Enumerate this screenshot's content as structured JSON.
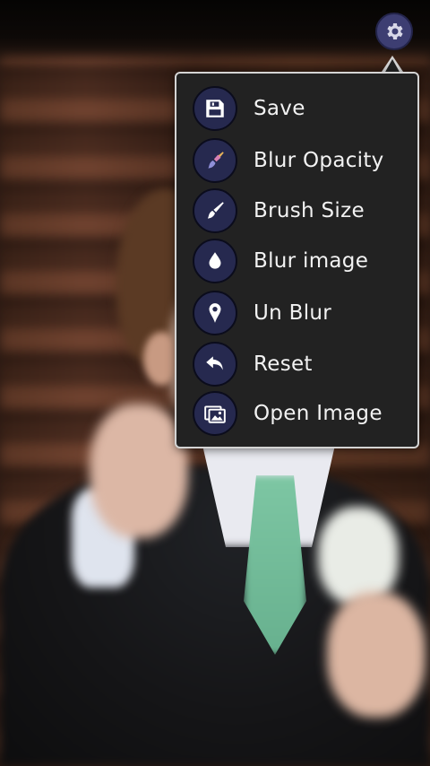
{
  "settings_button": {
    "icon": "gear-icon"
  },
  "menu": {
    "items": [
      {
        "label": "Save",
        "icon": "floppy-disk-icon"
      },
      {
        "label": "Blur Opacity",
        "icon": "paintbrush-color-icon"
      },
      {
        "label": "Brush Size",
        "icon": "paintbrush-icon"
      },
      {
        "label": "Blur image",
        "icon": "droplet-icon"
      },
      {
        "label": "Un Blur",
        "icon": "map-pin-icon"
      },
      {
        "label": "Reset",
        "icon": "undo-arrow-icon"
      },
      {
        "label": "Open Image",
        "icon": "images-icon"
      }
    ]
  },
  "colors": {
    "icon_circle": "#26294f",
    "menu_background": "#222222",
    "menu_border": "#d4d4d4",
    "gear_button": "#3d3e72"
  }
}
